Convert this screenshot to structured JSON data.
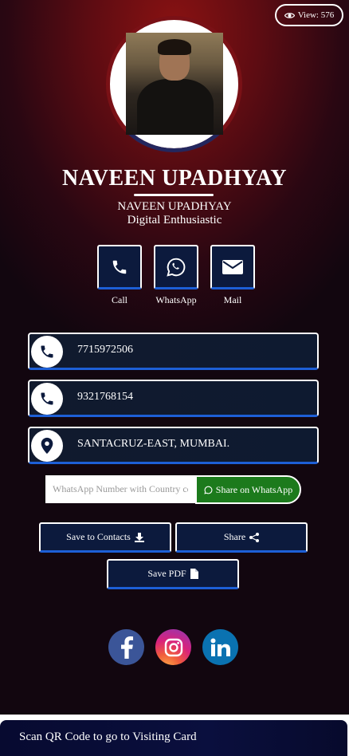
{
  "view_badge": {
    "icon": "eye-icon",
    "label": "View: 576"
  },
  "profile": {
    "name": "NAVEEN UPADHYAY",
    "subtitle_name": "NAVEEN UPADHYAY",
    "tagline": "Digital Enthusiastic"
  },
  "quick_actions": [
    {
      "label": "Call",
      "icon": "phone-icon"
    },
    {
      "label": "WhatsApp",
      "icon": "whatsapp-icon"
    },
    {
      "label": "Mail",
      "icon": "mail-icon"
    }
  ],
  "contact_rows": [
    {
      "icon": "phone-icon",
      "text": "7715972506"
    },
    {
      "icon": "phone-icon",
      "text": "9321768154"
    },
    {
      "icon": "location-pin-icon",
      "text": "SANTACRUZ-EAST, MUMBAI."
    }
  ],
  "whatsapp_share": {
    "placeholder": "WhatsApp Number with Country code",
    "value": "",
    "button_label": "Share on WhatsApp"
  },
  "buttons": {
    "save_contacts": "Save to Contacts",
    "share": "Share",
    "save_pdf": "Save PDF"
  },
  "social": [
    "facebook-icon",
    "instagram-icon",
    "linkedin-icon"
  ],
  "footer": {
    "qr_label": "Scan QR Code to go to Visiting Card"
  },
  "colors": {
    "accent_blue": "#1d5fd6",
    "button_bg": "#0c1a3d",
    "whatsapp_green": "#1c7a1c",
    "bg_red": "#8a1212"
  }
}
